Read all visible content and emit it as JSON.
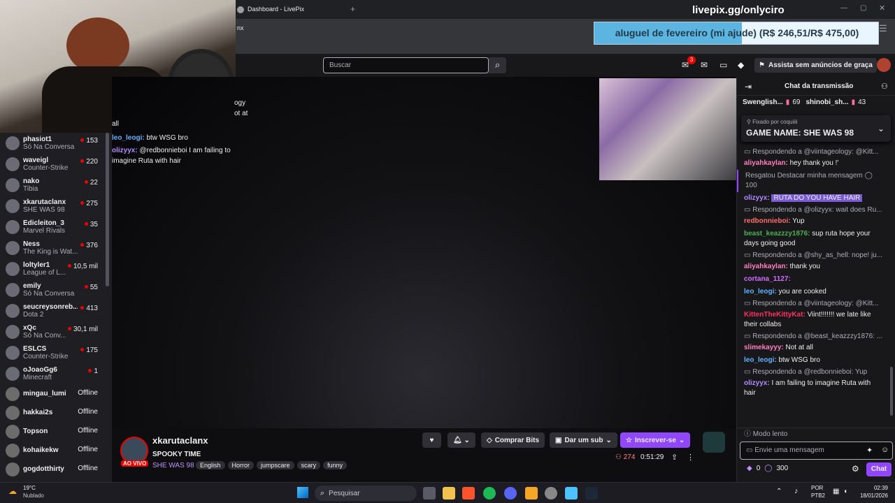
{
  "browser": {
    "tab_title": "Dashboard - LivePix",
    "addr_fragment": "nx"
  },
  "overlay": {
    "url": "livepix.gg/onlyciro",
    "goal_title": "aluguel de fevereiro (mi ajude)",
    "goal_amount": "(R$ 246,51/R$ 475,00)",
    "goal_progress": 0.519
  },
  "topnav": {
    "search_placeholder": "Buscar",
    "notif_count": "3",
    "promo": "Assista sem anúncios de graça"
  },
  "sidebar": {
    "items": [
      {
        "name": "phasiot1",
        "game": "Só Na Conversa",
        "viewers": "153"
      },
      {
        "name": "waveigl",
        "game": "Counter-Strike",
        "viewers": "220"
      },
      {
        "name": "nako",
        "game": "Tibia",
        "viewers": "22"
      },
      {
        "name": "xkarutaclanx",
        "game": "SHE WAS 98",
        "viewers": "275"
      },
      {
        "name": "Edicleiton_3",
        "game": "Marvel Rivals",
        "viewers": "35"
      },
      {
        "name": "Ness",
        "game": "The King is Wat...",
        "viewers": "376"
      },
      {
        "name": "loltyler1",
        "game": "League of L...",
        "viewers": "10,5 mil"
      },
      {
        "name": "emily",
        "game": "Só Na Conversa",
        "viewers": "55"
      },
      {
        "name": "seucreysonreb...",
        "game": "Dota 2",
        "viewers": "413"
      },
      {
        "name": "xQc",
        "game": "Só Na Conv...",
        "viewers": "30,1 mil"
      },
      {
        "name": "ESLCS",
        "game": "Counter-Strike",
        "viewers": "175"
      },
      {
        "name": "oJoaoGg6",
        "game": "Minecraft",
        "viewers": "1"
      }
    ],
    "offline": [
      {
        "name": "mingau_lumi",
        "status": "Offline"
      },
      {
        "name": "hakkai2s",
        "status": "Offline"
      },
      {
        "name": "Topson",
        "status": "Offline"
      },
      {
        "name": "kohaikekw",
        "status": "Offline"
      },
      {
        "name": "gogdotthirty",
        "status": "Offline"
      }
    ]
  },
  "overlay_chat": {
    "frag1": "ogy",
    "frag2": "ot at",
    "frag3": "all",
    "line1_user": "leo_leogi:",
    "line1_msg": "btw WSG bro",
    "line2_user": "olizyyx:",
    "line2_msg": "@redbonnieboi I am failing to imagine Ruta with hair"
  },
  "stream": {
    "channel": "xkarutaclanx",
    "title": "SPOOKY TIME",
    "live_label": "AO VIVO",
    "game": "SHE WAS 98",
    "tags": [
      "English",
      "Horror",
      "jumpscare",
      "scary",
      "funny"
    ],
    "viewers": "274",
    "uptime": "0:51:29",
    "bits_label": "Comprar Bits",
    "sub_label": "Dar um sub",
    "follow_label": "Inscrever-se"
  },
  "chat": {
    "header": "Chat da transmissão",
    "gifters": [
      {
        "name": "Swenglish...",
        "count": "69"
      },
      {
        "name": "shinobi_sh...",
        "count": "43"
      }
    ],
    "pinned_by": "Fixado por",
    "pinned_user": "coquiiii",
    "pinned_text": "GAME NAME: SHE WAS 98",
    "messages": [
      {
        "reply": "Respondendo a @viintageology: @Kitt..."
      },
      {
        "user": "aliyahkaylan:",
        "msg": "hey thank you !'",
        "color": "#ff7fbf"
      },
      {
        "redeem": "Resgatou Destacar minha mensagem",
        "cost": "100"
      },
      {
        "user": "olizyyx:",
        "msg": "RUTA DO YOU HAVE HAIR",
        "color": "#b58aff",
        "highlight": true
      },
      {
        "reply": "Respondendo a @olizyyx: wait does Ru..."
      },
      {
        "user": "redbonnieboi:",
        "msg": "Yup",
        "color": "#ff6b6b"
      },
      {
        "user": "beast_keazzzy1876:",
        "msg": "sup ruta hope your days going good",
        "color": "#4caf50"
      },
      {
        "reply": "Respondendo a @shy_as_hell: nope! ju..."
      },
      {
        "user": "aliyahkaylan:",
        "msg": "thank you",
        "color": "#ff7fbf"
      },
      {
        "user": "cortana_1127:",
        "msg": "",
        "color": "#d36cff"
      },
      {
        "user": "leo_leogi:",
        "msg": "you are cooked",
        "color": "#5fb3ff"
      },
      {
        "reply": "Respondendo a @viintageology: @Kitt..."
      },
      {
        "user": "KittenTheKittyKat:",
        "msg": "Viint!!!!!!! we late like their collabs",
        "color": "#ff3060"
      },
      {
        "reply": "Respondendo a @beast_keazzzy1876: ..."
      },
      {
        "user": "slimekayyy:",
        "msg": "Not at all",
        "color": "#ff7fbf"
      },
      {
        "user": "leo_leogi:",
        "msg": "btw WSG bro",
        "color": "#5fb3ff"
      },
      {
        "reply": "Respondendo a @redbonnieboi: Yup"
      },
      {
        "user": "olizyyx:",
        "msg": "I am failing to imagine Ruta with hair",
        "color": "#b58aff"
      }
    ],
    "slow_mode": "Modo lento",
    "input_placeholder": "Envie uma mensagem",
    "bits": "0",
    "points": "300",
    "send_label": "Chat"
  },
  "taskbar": {
    "temp": "19°C",
    "weather": "Nublado",
    "search": "Pesquisar",
    "lang1": "POR",
    "lang2": "PTB2",
    "time": "02:39",
    "date": "18/01/2026"
  }
}
